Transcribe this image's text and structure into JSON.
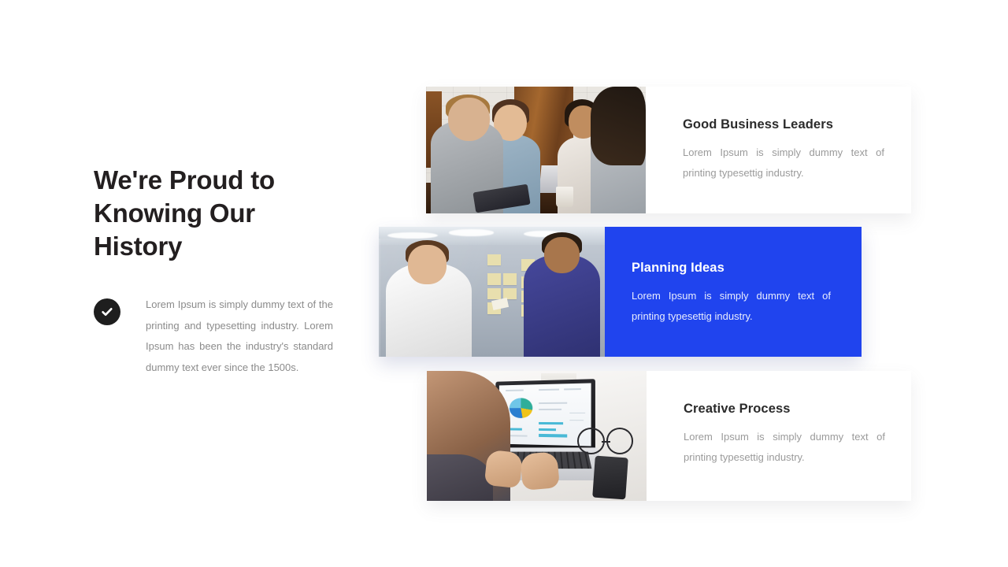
{
  "left": {
    "headline": "We're Proud to Knowing Our History",
    "bullet_icon": "check-circle-icon",
    "bullet_text": "Lorem Ipsum is simply dummy text of the printing and typesetting industry. Lorem Ipsum has been the industry's standard dummy text ever since the 1500s."
  },
  "cards": [
    {
      "title": "Good Business Leaders",
      "description": "Lorem Ipsum is simply dummy text of printing typesettig industry.",
      "image_alt": "team-meeting-photo",
      "highlighted": false
    },
    {
      "title": "Planning Ideas",
      "description": "Lorem Ipsum is simply dummy text of printing typesettig industry.",
      "image_alt": "sticky-note-workshop-photo",
      "highlighted": true
    },
    {
      "title": "Creative Process",
      "description": "Lorem Ipsum is simply dummy text of printing typesettig industry.",
      "image_alt": "laptop-dashboard-photo",
      "highlighted": false
    }
  ],
  "colors": {
    "accent_blue": "#2044ee",
    "heading_dark": "#231f20",
    "body_gray": "#8b8b8b",
    "badge_dark": "#1e1e1e",
    "page_background": "#ffffff"
  }
}
